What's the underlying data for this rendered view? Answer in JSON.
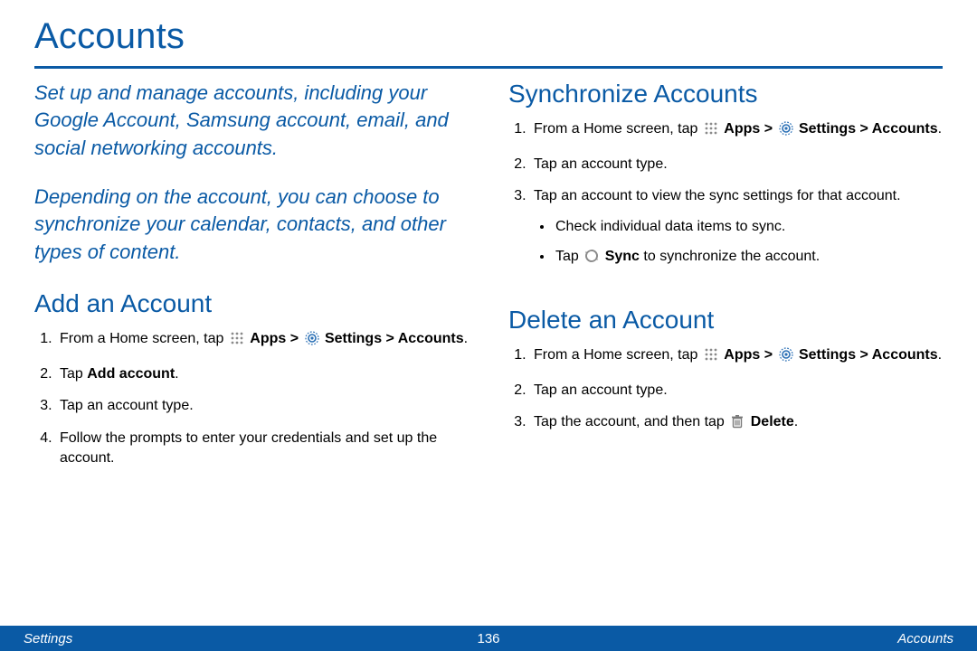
{
  "title": "Accounts",
  "intro": {
    "p1": "Set up and manage accounts, including your Google Account, Samsung account, email, and social networking accounts.",
    "p2": "Depending on the account, you can choose to synchronize your calendar, contacts, and other types of content."
  },
  "labels": {
    "apps": "Apps",
    "settings": "Settings",
    "accounts": "Accounts",
    "add_account": "Add account",
    "sync": "Sync",
    "delete": "Delete",
    "sep": " > "
  },
  "add": {
    "heading": "Add an Account",
    "s1_lead": "From a Home screen, tap ",
    "s2_lead": "Tap ",
    "s3": "Tap an account type.",
    "s4": "Follow the prompts to enter your credentials and set up the account."
  },
  "sync": {
    "heading": "Synchronize Accounts",
    "s1_lead": "From a Home screen, tap ",
    "s2": "Tap an account type.",
    "s3": "Tap an account to view the sync settings for that account.",
    "b1": "Check individual data items to sync.",
    "b2_lead": "Tap ",
    "b2_tail": " to synchronize the account."
  },
  "del": {
    "heading": "Delete an Account",
    "s1_lead": "From a Home screen, tap ",
    "s2": "Tap an account type.",
    "s3_lead": "Tap the account, and then tap "
  },
  "footer": {
    "left": "Settings",
    "page": "136",
    "right": "Accounts"
  }
}
